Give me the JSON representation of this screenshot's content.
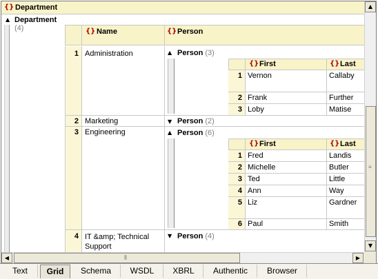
{
  "root": {
    "label": "Department"
  },
  "dept_group": {
    "label": "Department",
    "count": "(4)"
  },
  "columns": {
    "name": "Name",
    "person": "Person"
  },
  "departments": [
    {
      "num": "1",
      "name": "Administration",
      "person_label": "Person",
      "person_count": "(3)"
    },
    {
      "num": "2",
      "name": "Marketing",
      "person_label": "Person",
      "person_count": "(2)"
    },
    {
      "num": "3",
      "name": "Engineering",
      "person_label": "Person",
      "person_count": "(6)"
    },
    {
      "num": "4",
      "name": "IT &amp; Technical Support",
      "person_label": "Person",
      "person_count": "(4)"
    }
  ],
  "person_columns": {
    "first": "First",
    "last": "Last"
  },
  "admin_people": [
    {
      "num": "1",
      "first": "Vernon",
      "last": "Callaby"
    },
    {
      "num": "2",
      "first": "Frank",
      "last": "Further"
    },
    {
      "num": "3",
      "first": "Loby",
      "last": "Matise"
    }
  ],
  "eng_people": [
    {
      "num": "1",
      "first": "Fred",
      "last": "Landis"
    },
    {
      "num": "2",
      "first": "Michelle",
      "last": "Butler"
    },
    {
      "num": "3",
      "first": "Ted",
      "last": "Little"
    },
    {
      "num": "4",
      "first": "Ann",
      "last": "Way"
    },
    {
      "num": "5",
      "first": "Liz",
      "last": "Gardner"
    },
    {
      "num": "6",
      "first": "Paul",
      "last": "Smith"
    }
  ],
  "tabs": [
    "Text",
    "Grid",
    "Schema",
    "WSDL",
    "XBRL",
    "Authentic",
    "Browser"
  ],
  "active_tab": "Grid",
  "icons": {
    "element": "element-brace-icon",
    "expand": "triangle-up-icon",
    "collapse": "triangle-down-icon"
  }
}
